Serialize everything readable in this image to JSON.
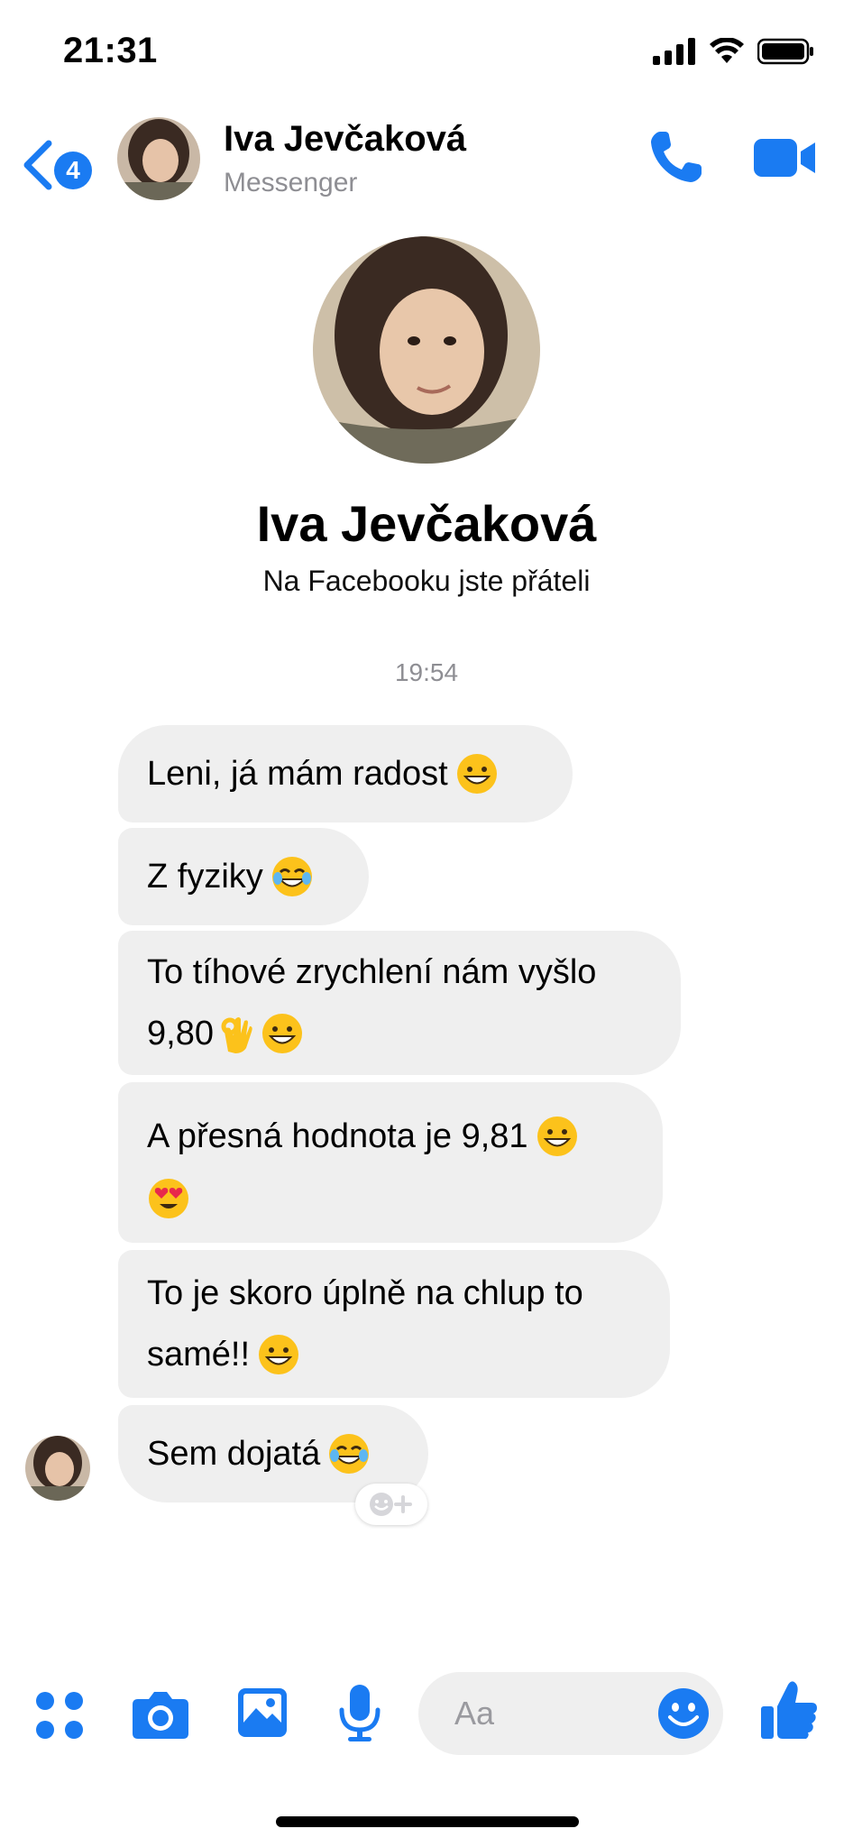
{
  "status_bar": {
    "time": "21:31"
  },
  "header": {
    "back_badge": "4",
    "name": "Iva Jevčaková",
    "subtitle": "Messenger"
  },
  "profile": {
    "name": "Iva Jevčaková",
    "subtitle": "Na Facebooku jste přáteli"
  },
  "timestamp": "19:54",
  "messages": [
    {
      "lines": [
        "Leni, já mám radost"
      ],
      "emoji_after": [
        "grinning-face"
      ]
    },
    {
      "lines": [
        "Z fyziky"
      ],
      "emoji_after": [
        "tears-of-joy"
      ]
    },
    {
      "lines": [
        "To tíhové zrychlení nám vyšlo",
        "9,80"
      ],
      "emoji_after": [
        "ok-hand",
        "grinning-face"
      ]
    },
    {
      "lines": [
        "A přesná hodnota je 9,81"
      ],
      "emoji_after": [
        "grinning-face",
        "heart-eyes"
      ]
    },
    {
      "lines": [
        "To je skoro úplně na chlup to",
        "samé!!"
      ],
      "emoji_after": [
        "grinning-face"
      ]
    },
    {
      "lines": [
        "Sem dojatá"
      ],
      "emoji_after": [
        "tears-of-joy"
      ]
    }
  ],
  "composer": {
    "placeholder": "Aa"
  },
  "colors": {
    "accent": "#1a7bf2",
    "bubble": "#efefef",
    "muted": "#8e8e93"
  }
}
